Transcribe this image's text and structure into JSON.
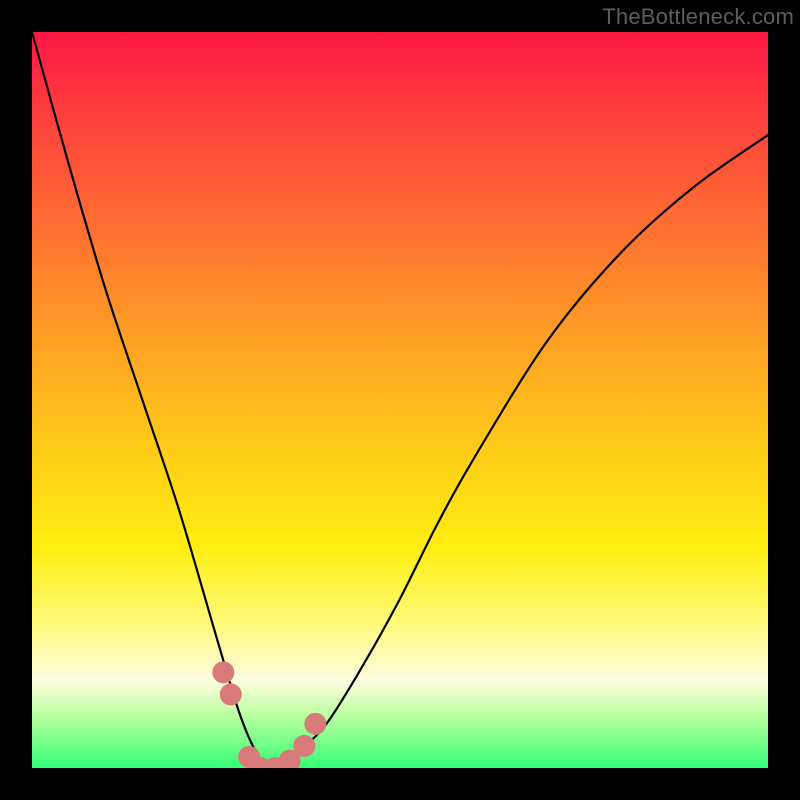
{
  "watermark": "TheBottleneck.com",
  "chart_data": {
    "type": "line",
    "title": "",
    "xlabel": "",
    "ylabel": "",
    "xlim": [
      0,
      100
    ],
    "ylim": [
      0,
      100
    ],
    "grid": false,
    "legend": false,
    "series": [
      {
        "name": "bottleneck-curve",
        "x": [
          0,
          5,
          10,
          15,
          20,
          25,
          28,
          30,
          32,
          34,
          36,
          40,
          45,
          50,
          55,
          60,
          70,
          80,
          90,
          100
        ],
        "y": [
          100,
          82,
          65,
          50,
          35,
          18,
          8,
          3,
          0,
          0,
          2,
          6,
          14,
          23,
          33,
          42,
          58,
          70,
          79,
          86
        ]
      }
    ],
    "markers": {
      "name": "highlight-points",
      "color": "#d87a7a",
      "x": [
        26,
        27,
        29.5,
        31,
        33,
        35,
        37,
        38.5
      ],
      "y": [
        13,
        10,
        1.5,
        0,
        0,
        1,
        3,
        6
      ]
    }
  }
}
